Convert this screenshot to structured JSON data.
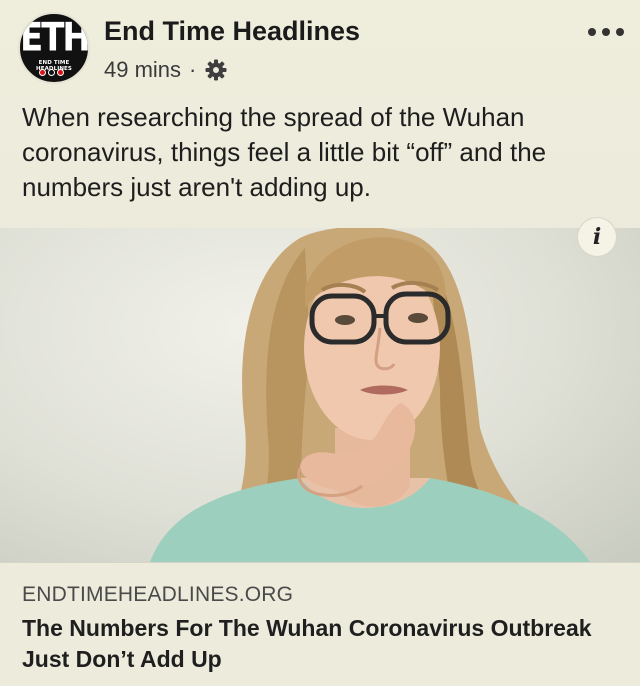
{
  "post": {
    "page_name": "End Time Headlines",
    "avatar": {
      "logo_text": "ETH",
      "logo_subtext": "END TIME HEADLINES"
    },
    "time": "49 mins",
    "separator": "·",
    "audience_icon": "gear-icon",
    "more_icon": "more-dots-icon",
    "text": "When researching the spread of the Wuhan coronavirus, things feel a little bit “off” and the numbers just aren't adding up."
  },
  "link": {
    "info_glyph": "i",
    "domain": "ENDTIMEHEADLINES.ORG",
    "headline": "The Numbers For The Wuhan Coronavirus Outbreak Just Don’t Add Up"
  },
  "colors": {
    "background": "#ecebdc",
    "text": "#1e1e1e",
    "avatar_bg": "#111111",
    "avatar_accent": "#dd1111"
  }
}
